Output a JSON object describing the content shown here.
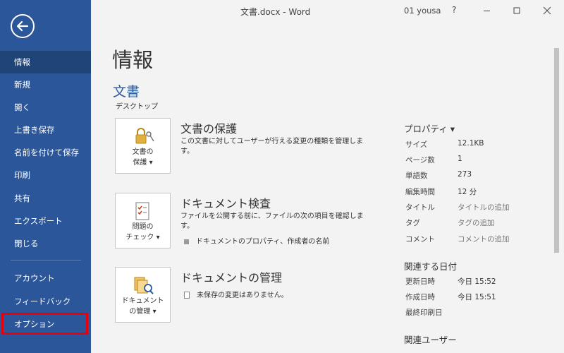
{
  "window": {
    "doc_title": "文書.docx  -  Word",
    "user": "01 yousa",
    "help": "?"
  },
  "sidebar": {
    "items": [
      {
        "label": "情報"
      },
      {
        "label": "新規"
      },
      {
        "label": "開く"
      },
      {
        "label": "上書き保存"
      },
      {
        "label": "名前を付けて保存"
      },
      {
        "label": "印刷"
      },
      {
        "label": "共有"
      },
      {
        "label": "エクスポート"
      },
      {
        "label": "閉じる"
      },
      {
        "label": "アカウント"
      },
      {
        "label": "フィードバック"
      },
      {
        "label": "オプション"
      }
    ]
  },
  "main": {
    "page_title": "情報",
    "doc_name": "文書",
    "doc_location": "デスクトップ",
    "sections": [
      {
        "tile_label_1": "文書の",
        "tile_label_2": "保護 ▾",
        "title": "文書の保護",
        "desc": "この文書に対してユーザーが行える変更の種類を管理します。"
      },
      {
        "tile_label_1": "問題の",
        "tile_label_2": "チェック ▾",
        "title": "ドキュメント検査",
        "desc": "ファイルを公開する前に、ファイルの次の項目を確認します。",
        "bullet": "ドキュメントのプロパティ、作成者の名前"
      },
      {
        "tile_label_1": "ドキュメント",
        "tile_label_2": "の管理 ▾",
        "title": "ドキュメントの管理",
        "bullet": "未保存の変更はありません。"
      }
    ]
  },
  "properties": {
    "heading": "プロパティ ▾",
    "rows": [
      {
        "key": "サイズ",
        "value": "12.1KB"
      },
      {
        "key": "ページ数",
        "value": "1"
      },
      {
        "key": "単語数",
        "value": "273"
      },
      {
        "key": "編集時間",
        "value": "12 分"
      },
      {
        "key": "タイトル",
        "value": "タイトルの追加"
      },
      {
        "key": "タグ",
        "value": "タグの追加"
      },
      {
        "key": "コメント",
        "value": "コメントの追加"
      }
    ],
    "dates_heading": "関連する日付",
    "dates": [
      {
        "key": "更新日時",
        "value": "今日 15:52"
      },
      {
        "key": "作成日時",
        "value": "今日 15:51"
      },
      {
        "key": "最終印刷日",
        "value": ""
      }
    ],
    "users_heading": "関連ユーザー"
  },
  "colors": {
    "sidebar": "#2b579a",
    "sidebar_active": "#1e4478",
    "highlight": "#e8000b",
    "accent": "#2b579a"
  }
}
